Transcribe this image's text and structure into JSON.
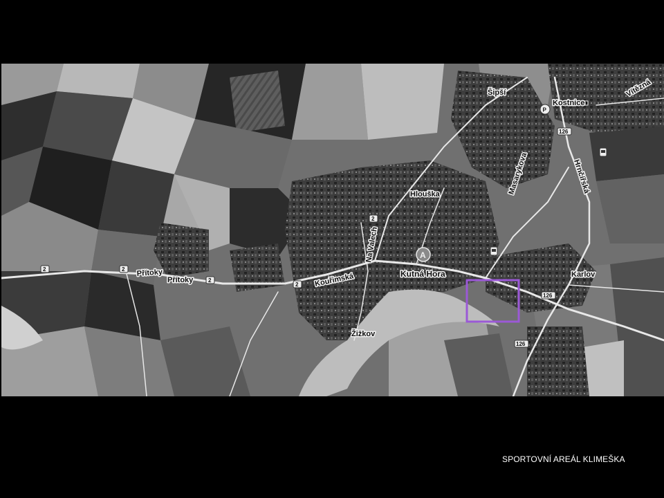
{
  "caption": "SPORTOVNÍ AREÁL KLIMEŠKA",
  "map": {
    "style": "grayscale aerial imagery",
    "labels": {
      "place_kutna_hora": "Kutná Hora",
      "place_sipsi": "Šipší",
      "place_kostnice": "Kostnice",
      "place_hlouska": "Hlouška",
      "place_karlov": "Karlov",
      "place_zizkov": "Žižkov",
      "place_pritoky_1": "Přítoky",
      "place_pritoky_2": "Přítoky",
      "street_kourimska": "Kouřimská",
      "street_na_valech": "Na Valech",
      "street_masarykova": "Masarykova",
      "street_hrnirska": "Hrnčířská",
      "street_vitezna": "Vítězná"
    },
    "markers": {
      "pin_letter": "A",
      "road_2_a": "2",
      "road_2_b": "2",
      "road_2_c": "2",
      "road_2_d": "2",
      "road_2_e": "2",
      "road_126_a": "126",
      "road_126_b": "126",
      "road_126_c": "126",
      "parking_symbol": "P"
    },
    "highlight_color": "#9b59d6",
    "highlight_label": "Sportovní areál Klimeška"
  }
}
